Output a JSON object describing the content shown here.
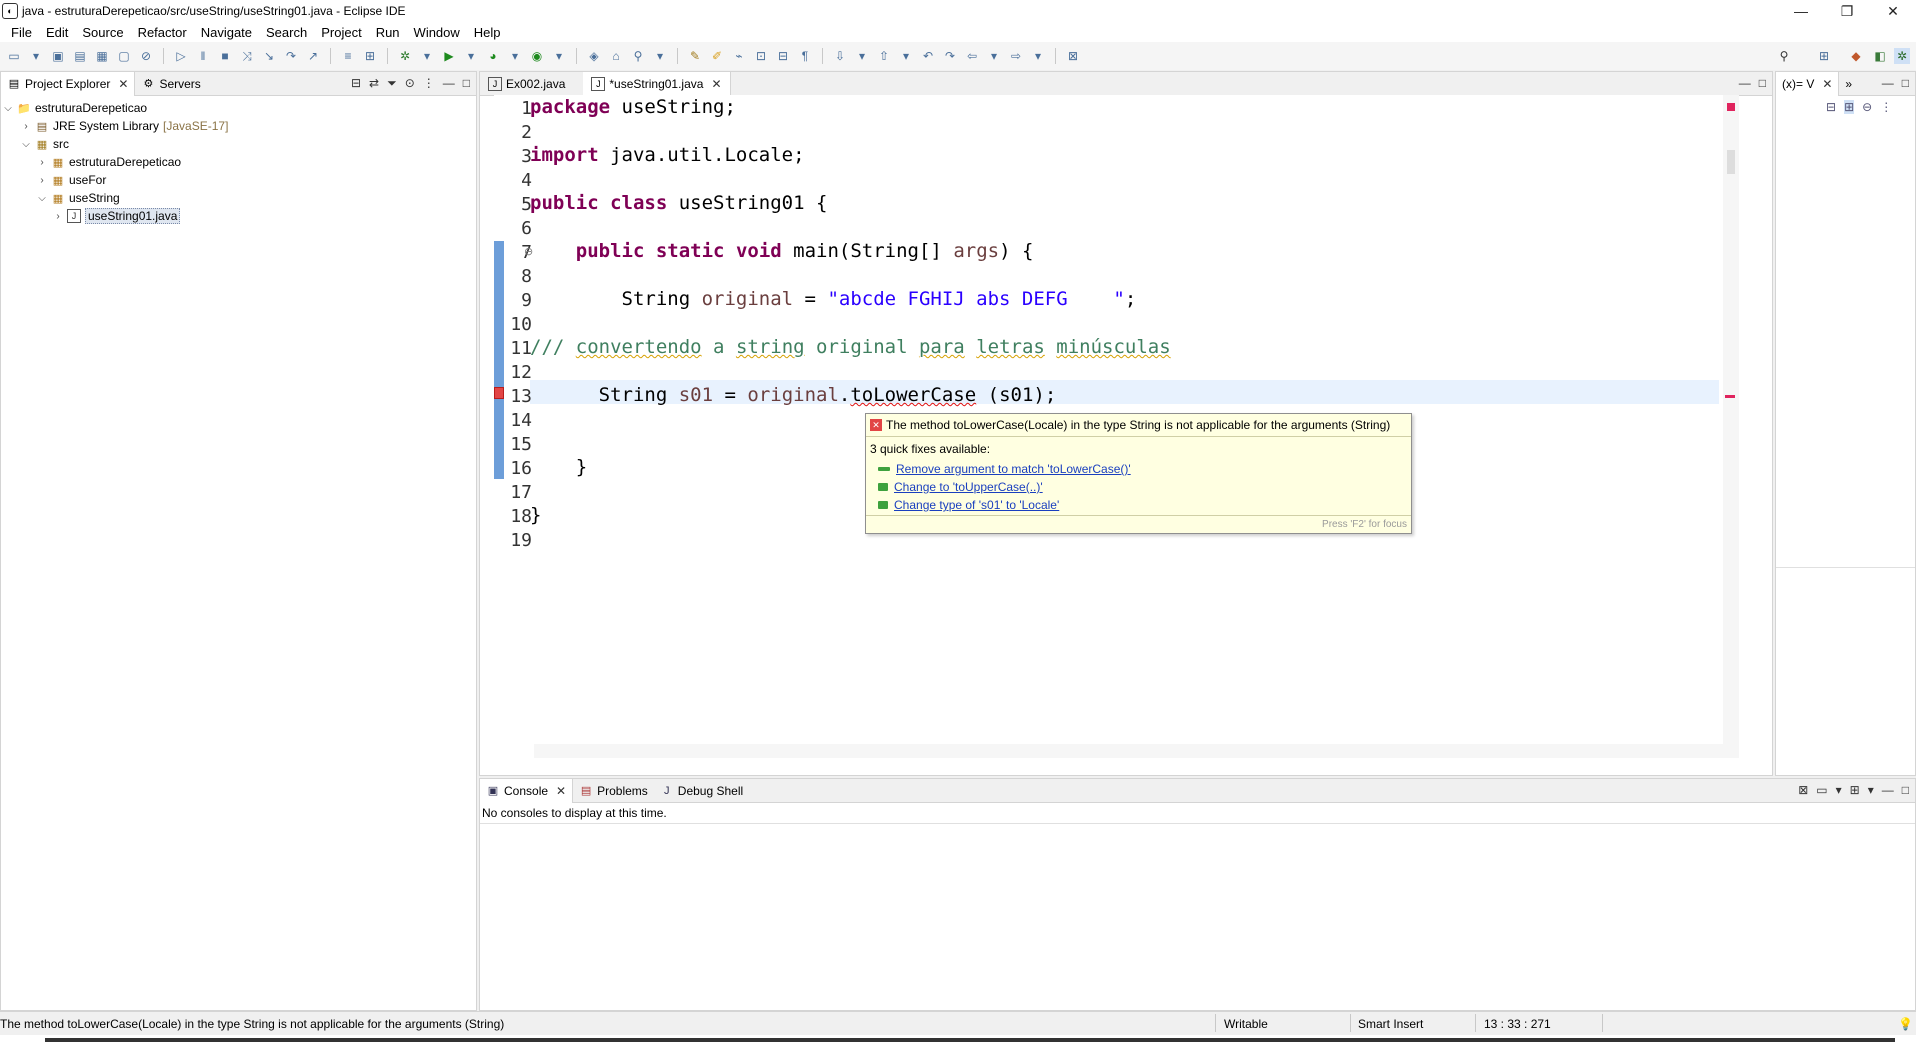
{
  "window": {
    "title": "java - estruturaDerepeticao/src/useString/useString01.java - Eclipse IDE",
    "minimize_glyph": "—",
    "restore_glyph": "❐",
    "close_glyph": "✕"
  },
  "menubar": [
    "File",
    "Edit",
    "Source",
    "Refactor",
    "Navigate",
    "Search",
    "Project",
    "Run",
    "Window",
    "Help"
  ],
  "project_explorer": {
    "tabs": [
      {
        "label": "Project Explorer",
        "close": "✕"
      },
      {
        "label": "Servers"
      }
    ],
    "tree": [
      {
        "label": "estruturaDerepeticao",
        "twisty": "⌵",
        "icon": "project-icon",
        "glyph": "📁"
      },
      {
        "label": "JRE System Library",
        "tag": "[JavaSE-17]",
        "twisty": "›",
        "icon": "library-icon",
        "glyph": "▤"
      },
      {
        "label": "src",
        "twisty": "⌵",
        "icon": "source-folder-icon",
        "glyph": "▦"
      },
      {
        "label": "estruturaDerepeticao",
        "twisty": "›",
        "icon": "package-icon",
        "glyph": "▦"
      },
      {
        "label": "useFor",
        "twisty": "›",
        "icon": "package-icon",
        "glyph": "▦"
      },
      {
        "label": "useString",
        "twisty": "⌵",
        "icon": "package-icon",
        "glyph": "▦"
      },
      {
        "label": "useString01.java",
        "twisty": "›",
        "icon": "java-file-icon",
        "glyph": "J"
      }
    ]
  },
  "editor": {
    "tabs": [
      {
        "label": "Ex002.java"
      },
      {
        "label": "*useString01.java",
        "close": "✕"
      }
    ],
    "line_numbers": [
      "1",
      "2",
      "3",
      "4",
      "5",
      "6",
      "7",
      "8",
      "9",
      "10",
      "11",
      "12",
      "13",
      "14",
      "15",
      "16",
      "17",
      "18",
      "19"
    ],
    "code": {
      "l1_kw": "package",
      "l1_rest": " useString;",
      "l3_kw": "import",
      "l3_rest": " java.util.Locale;",
      "l5_kw1": "public",
      "l5_kw2": "class",
      "l5_rest": " useString01 {",
      "l7_indent": "    ",
      "l7_kw1": "public",
      "l7_kw2": "static",
      "l7_kw3": "void",
      "l7_rest1": " main(String[] ",
      "l7_var": "args",
      "l7_rest2": ") {",
      "l9_indent": "        String ",
      "l9_var": "original",
      "l9_eq": " = ",
      "l9_str": "\"abcde FGHIJ abs DEFG    \"",
      "l9_end": ";",
      "l11_slashes": "/// ",
      "l11_w1": "convertendo",
      "l11_sp1": " a ",
      "l11_w2": "string",
      "l11_sp2": " original ",
      "l11_w3": "para",
      "l11_sp3": " ",
      "l11_w4": "letras",
      "l11_sp4": " ",
      "l11_w5": "minúsculas",
      "l13_indent": "      String ",
      "l13_var": "s01",
      "l13_eq": " = ",
      "l13_var2": "original",
      "l13_dot": ".",
      "l13_err": "toLowerCase",
      "l13_rest": " (s01);",
      "l16": "    }",
      "l18": "}"
    },
    "fold_glyph": "⊖"
  },
  "hover": {
    "message": "The method toLowerCase(Locale) in the type String is not applicable for the arguments (String)",
    "fixes_count": "3 quick fixes available:",
    "fixes": [
      "Remove argument to match 'toLowerCase()'",
      "Change to 'toUpperCase(..)'",
      "Change type of 's01' to 'Locale'"
    ],
    "focus_hint": "Press 'F2' for focus"
  },
  "right_panel": {
    "tab": "(x)= V",
    "close": "✕",
    "overflow": "»"
  },
  "console": {
    "tabs": [
      {
        "label": "Console",
        "close": "✕"
      },
      {
        "label": "Problems"
      },
      {
        "label": "Debug Shell"
      }
    ],
    "empty_text": "No consoles to display at this time."
  },
  "statusbar": {
    "message": "The method toLowerCase(Locale) in the type String is not applicable for the arguments (String)",
    "mode": "Writable",
    "insert": "Smart Insert",
    "position": "13 : 33 : 271"
  }
}
